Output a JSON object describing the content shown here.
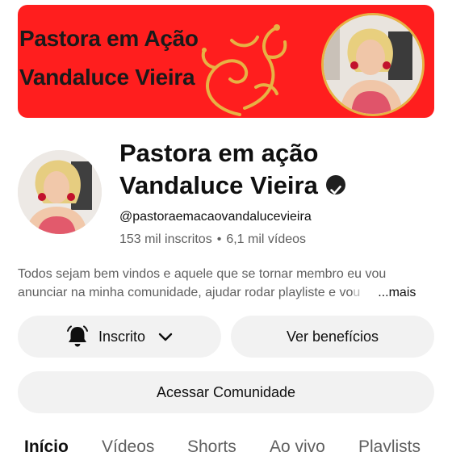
{
  "banner": {
    "line1": "Pastora em Ação",
    "line2": "Vandaluce Vieira"
  },
  "channel": {
    "name_line1": "Pastora em ação",
    "name_line2": "Vandaluce Vieira",
    "handle": "@pastoraemacaovandalucevieira",
    "subscribers": "153 mil inscritos",
    "separator": "•",
    "videos": "6,1 mil vídeos",
    "description_line1": "Todos sejam bem vindos e aquele que se tornar membro eu vou",
    "description_line2": "anunciar na minha comunidade, ajudar rodar playliste  e vo",
    "description_faded": "u",
    "more_label": "...mais"
  },
  "buttons": {
    "subscribed_label": "Inscrito",
    "benefits_label": "Ver benefícios",
    "community_label": "Acessar Comunidade"
  },
  "tabs": [
    {
      "label": "Início"
    },
    {
      "label": "Vídeos"
    },
    {
      "label": "Shorts"
    },
    {
      "label": "Ao vivo"
    },
    {
      "label": "Playlists"
    }
  ],
  "colors": {
    "banner_red": "#ff1e1e",
    "gold": "#e7b244",
    "pill_bg": "#f2f2f2",
    "secondary_text": "#606060"
  },
  "icons": [
    "verified-badge-icon",
    "bell-icon",
    "chevron-down-icon",
    "gold-ornament-icon"
  ]
}
